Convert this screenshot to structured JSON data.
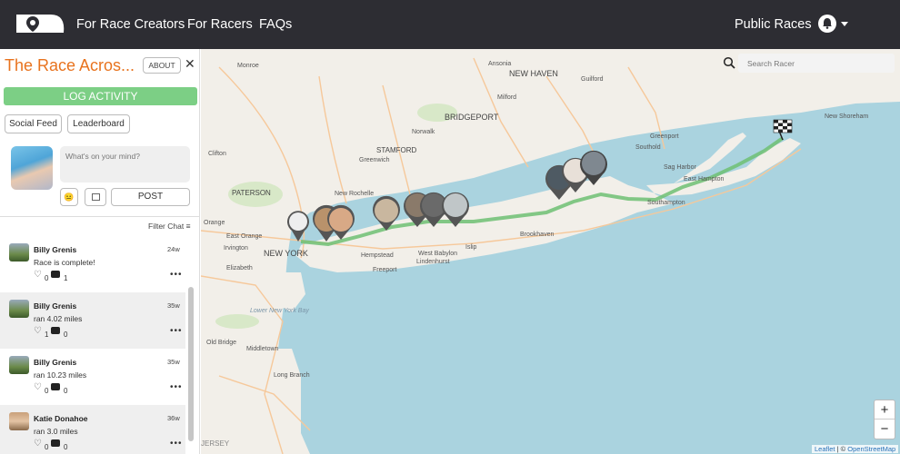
{
  "nav": {
    "links": [
      {
        "label": "For Race Creators"
      },
      {
        "label": "For Racers"
      },
      {
        "label": "FAQs"
      }
    ],
    "public_races": "Public Races",
    "logo_icon": "location-pin-logo-icon",
    "bell_icon": "bell-icon"
  },
  "sidebar": {
    "race_title": "The Race Acros...",
    "about": "ABOUT",
    "close": "✕",
    "log_activity": "LOG ACTIVITY",
    "tabs": [
      {
        "label": "Social Feed"
      },
      {
        "label": "Leaderboard"
      }
    ],
    "post_placeholder": "What's on your mind?",
    "emoji": "😐",
    "post_button": "POST",
    "filter_chat": "Filter Chat"
  },
  "feed": [
    {
      "name": "Billy Grenis",
      "time": "24w",
      "text": "Race is complete!",
      "likes": "0",
      "comments": "1"
    },
    {
      "name": "Billy Grenis",
      "time": "35w",
      "text": "ran 4.02 miles",
      "likes": "1",
      "comments": "0"
    },
    {
      "name": "Billy Grenis",
      "time": "35w",
      "text": "ran 10.23 miles",
      "likes": "0",
      "comments": "0"
    },
    {
      "name": "Katie Donahoe",
      "time": "36w",
      "text": "ran 3.0 miles",
      "likes": "0",
      "comments": "0"
    }
  ],
  "map": {
    "search_placeholder": "Search Racer",
    "zoom_in": "+",
    "zoom_out": "−",
    "attribution_leaflet": "Leaflet",
    "attribution_sep": " | © ",
    "attribution_osm": "OpenStreetMap",
    "labels": [
      "Monroe",
      "Ansonia",
      "NEW HAVEN",
      "Guilford",
      "Milford",
      "BRIDGEPORT",
      "New Shoreham",
      "Norwalk",
      "STAMFORD",
      "Greenwich",
      "Southold",
      "Greenport",
      "Sag Harbor",
      "East Hampton",
      "PATERSON",
      "New Rochelle",
      "Southampton",
      "Brookhaven",
      "Islip",
      "West Babylon",
      "Lindenhurst",
      "Hempstead",
      "Freeport",
      "NEW YORK",
      "East Orange",
      "Irvington",
      "Elizabeth",
      "Lower New York Bay",
      "Old Bridge",
      "Middletown",
      "Long Branch",
      "JERSEY",
      "Clifton",
      "Orange"
    ]
  },
  "colors": {
    "nav_bg": "#2d2d33",
    "accent_orange": "#e8731e",
    "accent_green": "#7ccf85",
    "route_green": "#6fbf73",
    "water": "#aad3df",
    "land": "#f2efe9"
  }
}
